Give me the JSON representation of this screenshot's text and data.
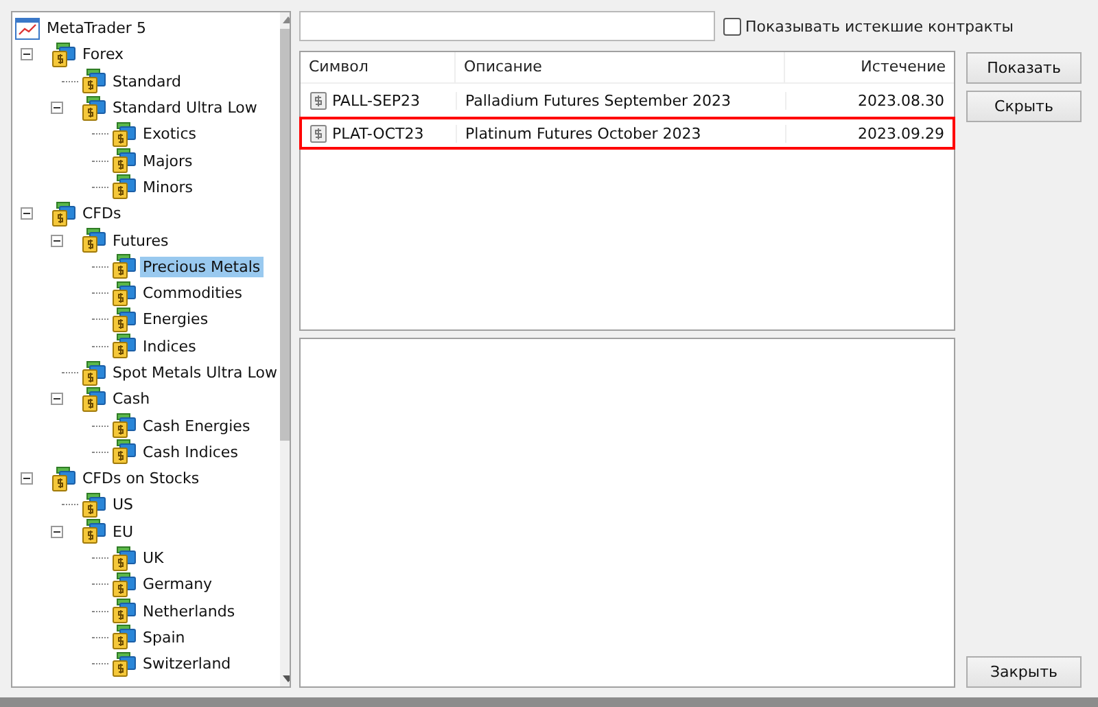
{
  "tree": {
    "label": "MetaTrader 5",
    "kind": "root",
    "selected": false,
    "children": [
      {
        "label": "Forex",
        "expanded": true,
        "selected": false,
        "children": [
          {
            "label": "Standard",
            "selected": false
          },
          {
            "label": "Standard Ultra Low",
            "expanded": true,
            "selected": false,
            "children": [
              {
                "label": "Exotics",
                "selected": false
              },
              {
                "label": "Majors",
                "selected": false
              },
              {
                "label": "Minors",
                "selected": false
              }
            ]
          }
        ]
      },
      {
        "label": "CFDs",
        "expanded": true,
        "selected": false,
        "children": [
          {
            "label": "Futures",
            "expanded": true,
            "selected": false,
            "children": [
              {
                "label": "Precious Metals",
                "selected": true
              },
              {
                "label": "Commodities",
                "selected": false
              },
              {
                "label": "Energies",
                "selected": false
              },
              {
                "label": "Indices",
                "selected": false
              }
            ]
          },
          {
            "label": "Spot Metals Ultra Low",
            "selected": false
          },
          {
            "label": "Cash",
            "expanded": true,
            "selected": false,
            "children": [
              {
                "label": "Cash Energies",
                "selected": false
              },
              {
                "label": "Cash Indices",
                "selected": false
              }
            ]
          }
        ]
      },
      {
        "label": "CFDs on Stocks",
        "expanded": true,
        "selected": false,
        "children": [
          {
            "label": "US",
            "selected": false
          },
          {
            "label": "EU",
            "expanded": true,
            "selected": false,
            "children": [
              {
                "label": "UK",
                "selected": false
              },
              {
                "label": "Germany",
                "selected": false
              },
              {
                "label": "Netherlands",
                "selected": false
              },
              {
                "label": "Spain",
                "selected": false
              },
              {
                "label": "Switzerland",
                "selected": false
              }
            ]
          }
        ]
      }
    ]
  },
  "show_expired": {
    "label": "Показывать истекшие контракты",
    "checked": false
  },
  "table": {
    "columns": [
      "Символ",
      "Описание",
      "Истечение"
    ],
    "rows": [
      {
        "symbol": "PALL-SEP23",
        "description": "Palladium Futures September 2023",
        "expiry": "2023.08.30",
        "highlighted": false
      },
      {
        "symbol": "PLAT-OCT23",
        "description": "Platinum Futures October 2023",
        "expiry": "2023.09.29",
        "highlighted": true
      }
    ]
  },
  "buttons": [
    "Показать",
    "Скрыть"
  ],
  "close_button": "Закрыть"
}
